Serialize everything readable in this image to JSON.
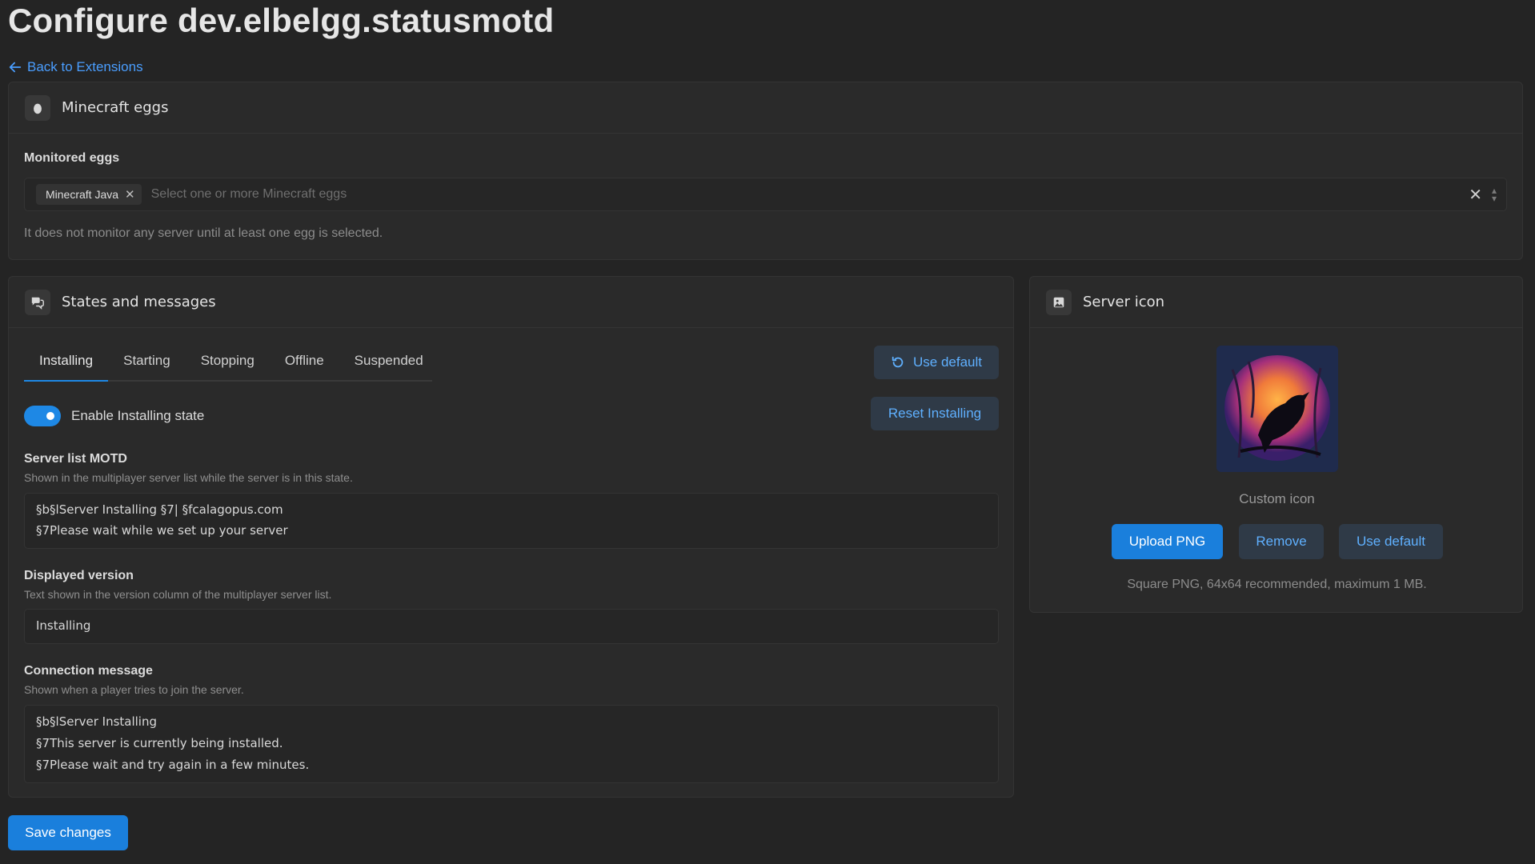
{
  "page": {
    "title": "Configure dev.elbelgg.statusmotd",
    "back_label": "Back to Extensions"
  },
  "eggs_card": {
    "title": "Minecraft eggs",
    "field_label": "Monitored eggs",
    "selected": [
      "Minecraft Java"
    ],
    "placeholder": "Select one or more Minecraft eggs",
    "help": "It does not monitor any server until at least one egg is selected."
  },
  "states_card": {
    "title": "States and messages",
    "tabs": [
      "Installing",
      "Starting",
      "Stopping",
      "Offline",
      "Suspended"
    ],
    "active_tab": "Installing",
    "use_default_label": "Use default",
    "reset_label": "Reset Installing",
    "toggle_label": "Enable Installing state",
    "toggle_on": true,
    "motd": {
      "label": "Server list MOTD",
      "help": "Shown in the multiplayer server list while the server is in this state.",
      "lines": [
        "§b§lServer Installing §7| §fcalagopus.com",
        "§7Please wait while we set up your server"
      ]
    },
    "version": {
      "label": "Displayed version",
      "help": "Text shown in the version column of the multiplayer server list.",
      "value": "Installing"
    },
    "connection": {
      "label": "Connection message",
      "help": "Shown when a player tries to join the server.",
      "lines": [
        "§b§lServer Installing",
        "§7This server is currently being installed.",
        "§7Please wait and try again in a few minutes."
      ]
    }
  },
  "icon_card": {
    "title": "Server icon",
    "caption": "Custom icon",
    "upload_label": "Upload PNG",
    "remove_label": "Remove",
    "default_label": "Use default",
    "hint": "Square PNG, 64x64 recommended, maximum 1 MB."
  },
  "save_label": "Save changes",
  "colors": {
    "background": "#242424",
    "card": "#2a2a2a",
    "accent": "#1e88e5",
    "link": "#4a9eff"
  }
}
